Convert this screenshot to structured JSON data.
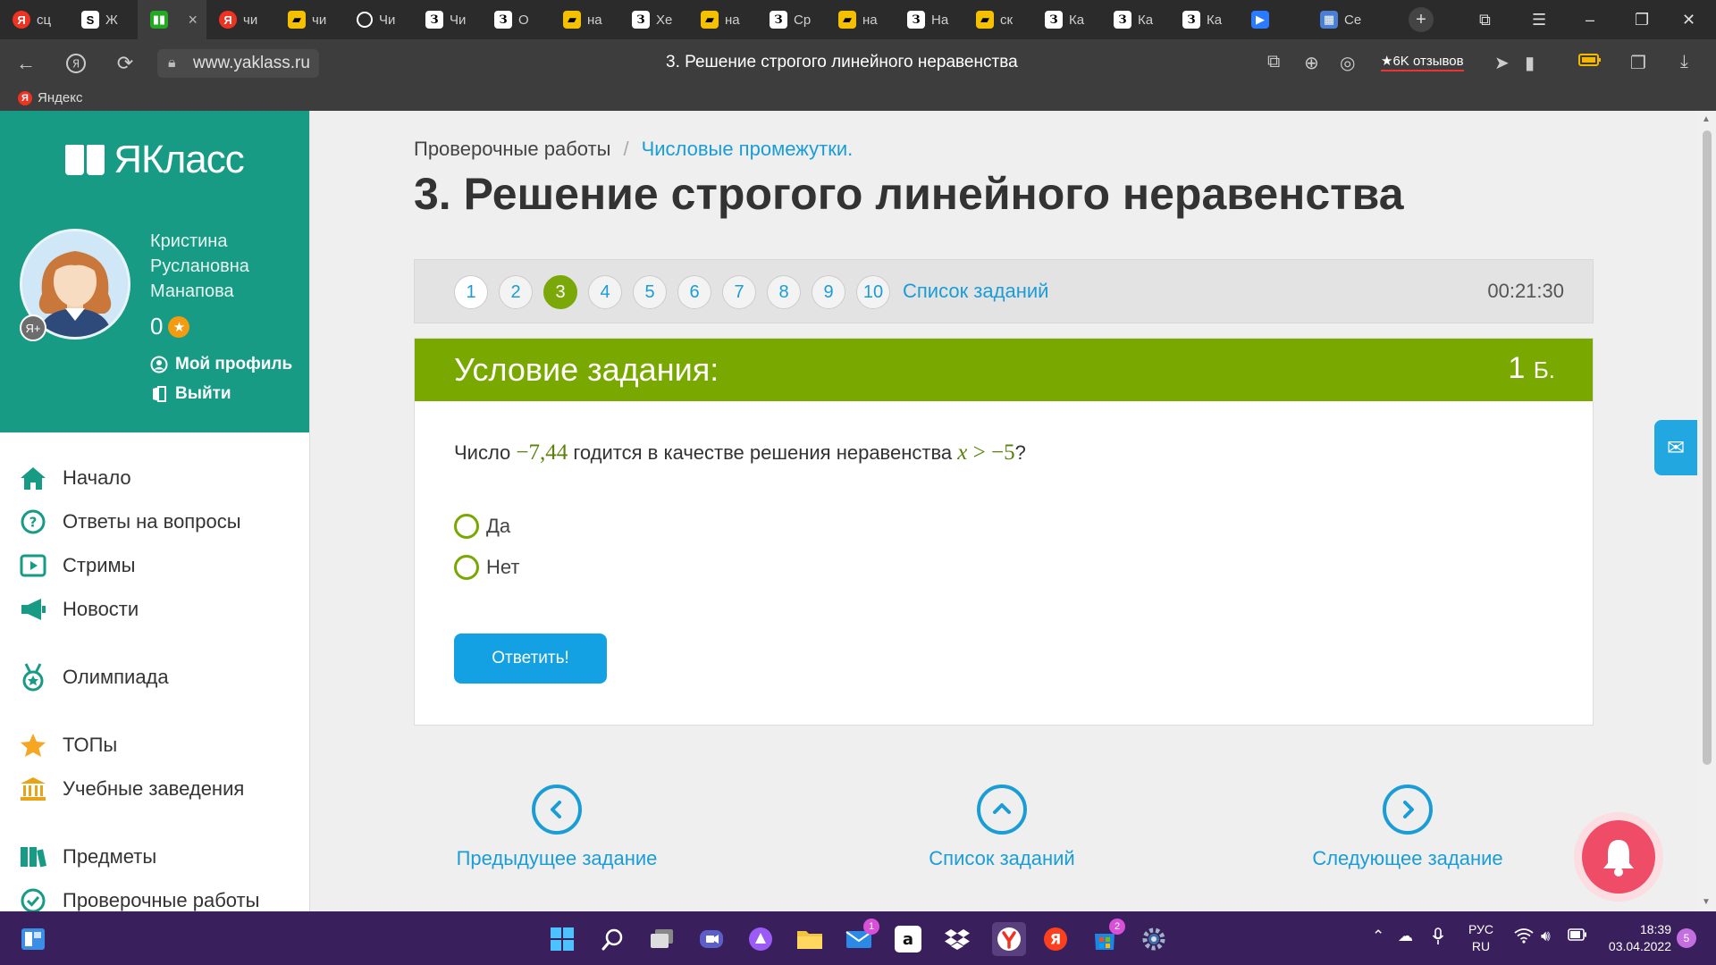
{
  "browser": {
    "tabs": [
      {
        "label": "сц",
        "fav": "y",
        "glyph": "Я"
      },
      {
        "label": "Ж",
        "fav": "s",
        "glyph": "S"
      },
      {
        "label": "",
        "fav": "g",
        "glyph": "▮▮",
        "active": true
      },
      {
        "label": "чи",
        "fav": "y",
        "glyph": "Я"
      },
      {
        "label": "чи",
        "fav": "k",
        "glyph": "▰"
      },
      {
        "label": "Чи",
        "fav": "o",
        "glyph": ""
      },
      {
        "label": "Чи",
        "fav": "z",
        "glyph": "З"
      },
      {
        "label": "О",
        "fav": "z",
        "glyph": "З"
      },
      {
        "label": "на",
        "fav": "k",
        "glyph": "▰"
      },
      {
        "label": "Хе",
        "fav": "z",
        "glyph": "З"
      },
      {
        "label": "на",
        "fav": "k",
        "glyph": "▰"
      },
      {
        "label": "Ср",
        "fav": "z",
        "glyph": "З"
      },
      {
        "label": "на",
        "fav": "k",
        "glyph": "▰"
      },
      {
        "label": "На",
        "fav": "z",
        "glyph": "З"
      },
      {
        "label": "ск",
        "fav": "k",
        "glyph": "▰"
      },
      {
        "label": "Ка",
        "fav": "z",
        "glyph": "З"
      },
      {
        "label": "Ка",
        "fav": "z",
        "glyph": "З"
      },
      {
        "label": "Ка",
        "fav": "z",
        "glyph": "З"
      },
      {
        "label": "",
        "fav": "p",
        "glyph": "▶"
      },
      {
        "label": "Се",
        "fav": "w",
        "glyph": "▦"
      }
    ],
    "url": "www.yaklass.ru",
    "page_title": "3. Решение строгого линейного неравенства",
    "reviews_label": "★6K отзывов",
    "bookmark": "Яндекс"
  },
  "sidebar": {
    "logo": "ЯКласс",
    "user_name": "Кристина Руслановна Манапова",
    "score": "0",
    "profile_link": "Мой профиль",
    "logout_link": "Выйти",
    "menu": [
      {
        "label": "Начало",
        "icon": "home-icon"
      },
      {
        "label": "Ответы на вопросы",
        "icon": "question-icon"
      },
      {
        "label": "Стримы",
        "icon": "play-icon"
      },
      {
        "label": "Новости",
        "icon": "megaphone-icon"
      },
      {
        "label": "Олимпиада",
        "icon": "medal-icon"
      },
      {
        "label": "ТОПы",
        "icon": "star-icon"
      },
      {
        "label": "Учебные заведения",
        "icon": "school-icon"
      },
      {
        "label": "Предметы",
        "icon": "books-icon"
      },
      {
        "label": "Проверочные работы",
        "icon": "check-icon"
      }
    ]
  },
  "main": {
    "breadcrumb_root": "Проверочные работы",
    "breadcrumb_sep": "/",
    "breadcrumb_link": "Числовые промежутки.",
    "heading": "3. Решение строгого линейного неравенства",
    "task_numbers": [
      "1",
      "2",
      "3",
      "4",
      "5",
      "6",
      "7",
      "8",
      "9",
      "10"
    ],
    "current_task": 3,
    "task_list_label": "Список заданий",
    "timer": "00:21:30",
    "condition_title": "Условие задания:",
    "points_value": "1",
    "points_unit": "Б.",
    "question_prefix": "Число",
    "question_number": "−7,44",
    "question_middle": "годится в качестве решения неравенства",
    "question_var": "x",
    "question_rel": " > −5",
    "question_suffix": "?",
    "options": [
      "Да",
      "Нет"
    ],
    "answer_button": "Ответить!",
    "prev_label": "Предыдущее задание",
    "list_label": "Список заданий",
    "next_label": "Следующее задание"
  },
  "taskbar": {
    "lang": "РУС",
    "lang_sub": "RU",
    "time": "18:39",
    "date": "03.04.2022",
    "notif_count": "5",
    "mail_badge": "1",
    "store_badge": "2"
  },
  "colors": {
    "brand_teal": "#179b85",
    "accent_green": "#79a800",
    "link_blue": "#1a9dd6",
    "button_blue": "#13a1e3"
  }
}
